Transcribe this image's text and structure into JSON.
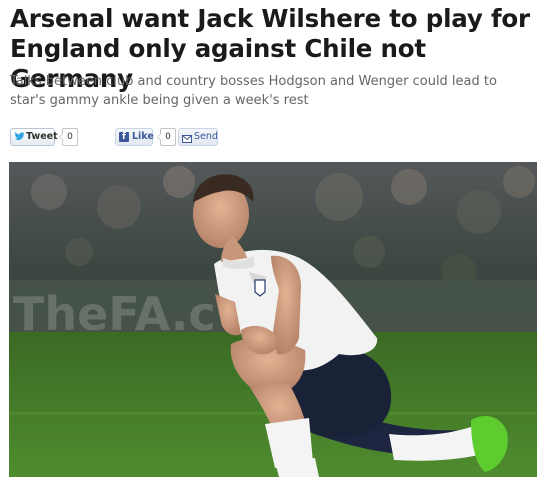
{
  "article": {
    "headline": "Arsenal want Jack Wilshere to play for England only against Chile not Germany",
    "standfirst": "Talks between club and country bosses Hodgson and Wenger could lead to star's gammy ankle being given a week's rest"
  },
  "share_bar": {
    "tweet_label": "Tweet",
    "tweet_count": "0",
    "like_label": "Like",
    "like_count": "0",
    "send_label": "Send",
    "twitter_icon": "twitter-bird-icon",
    "facebook_icon": "facebook-f-icon",
    "send_icon": "envelope-icon"
  },
  "photo": {
    "subject": "footballer-kneeling-on-pitch"
  },
  "colors": {
    "headline": "#1a1a1a",
    "standfirst": "#666666",
    "facebook_blue": "#3b5998",
    "pitch_green": "#3f7a2a"
  }
}
